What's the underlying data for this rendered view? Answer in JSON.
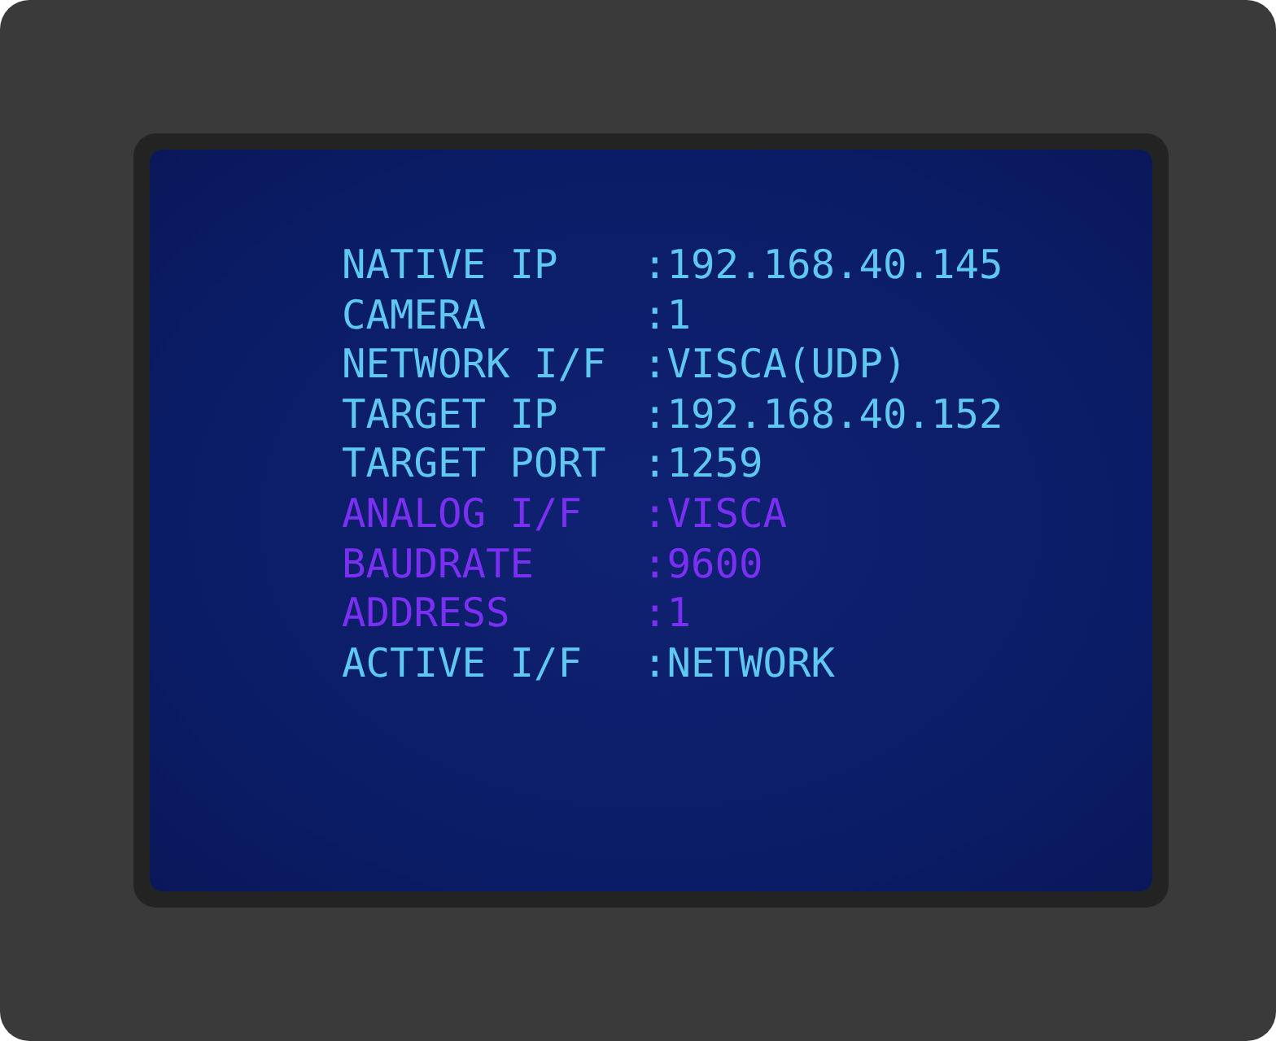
{
  "rows": [
    {
      "label": "NATIVE IP",
      "value": ":192.168.40.145",
      "color": "#5ec8f0"
    },
    {
      "label": "CAMERA",
      "value": ":1",
      "color": "#5ec8f0"
    },
    {
      "label": "NETWORK I/F",
      "value": ":VISCA(UDP)",
      "color": "#5ec8f0"
    },
    {
      "label": "TARGET IP",
      "value": ":192.168.40.152",
      "color": "#5ec8f0"
    },
    {
      "label": "TARGET PORT",
      "value": ":1259",
      "color": "#5ec8f0"
    },
    {
      "label": "ANALOG I/F",
      "value": ":VISCA",
      "color": "#7b2ff2"
    },
    {
      "label": "BAUDRATE",
      "value": ":9600",
      "color": "#7b2ff2"
    },
    {
      "label": "ADDRESS",
      "value": ":1",
      "color": "#7b2ff2"
    },
    {
      "label": "ACTIVE I/F",
      "value": ":NETWORK",
      "color": "#5ec8f0"
    }
  ]
}
